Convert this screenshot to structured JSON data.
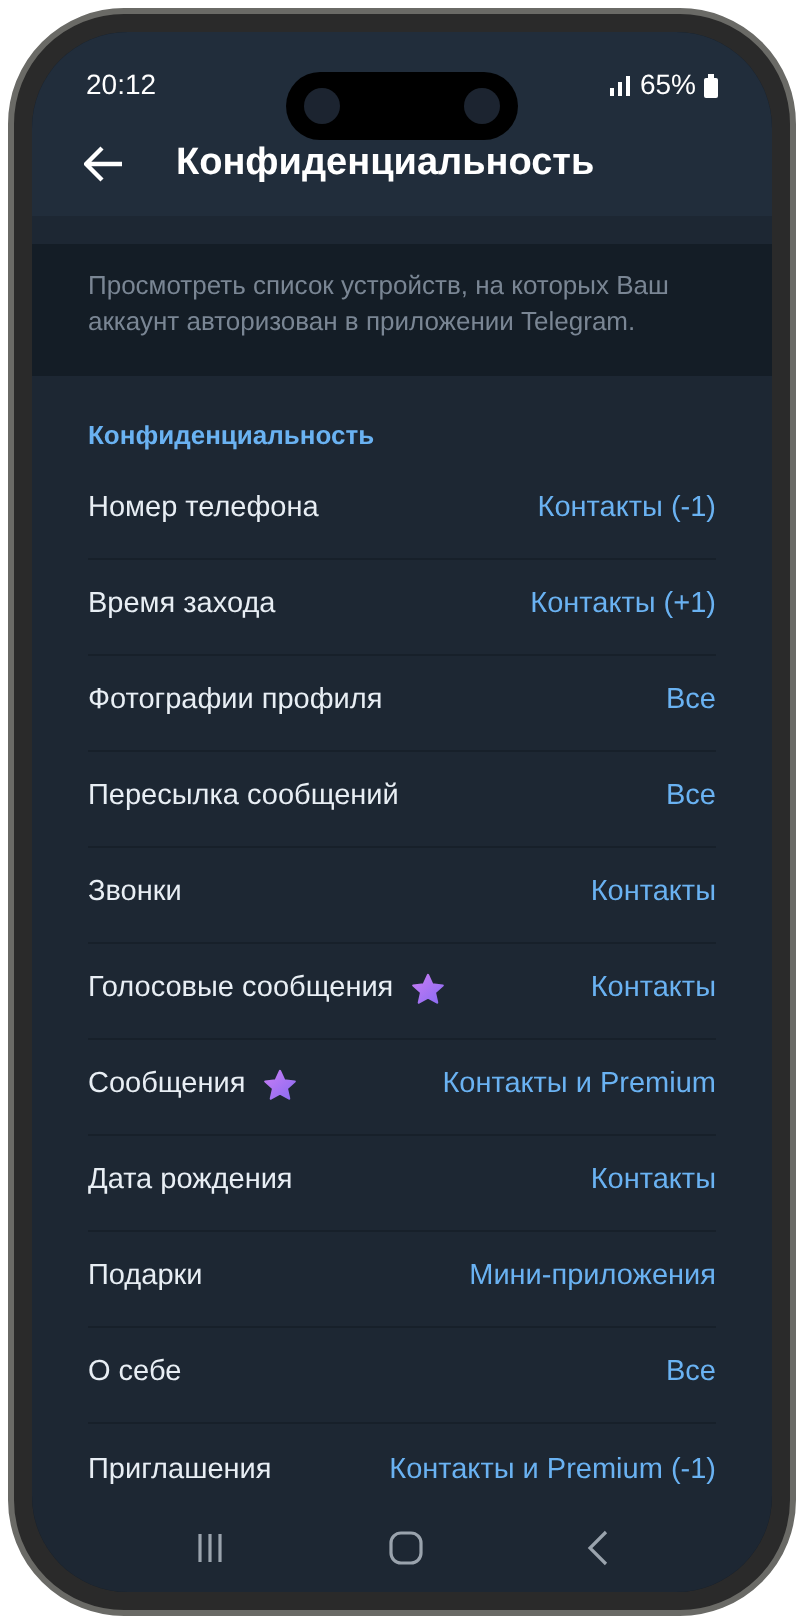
{
  "status_bar": {
    "time": "20:12",
    "battery": "65%"
  },
  "header": {
    "title": "Конфиденциальность"
  },
  "devices_note": "Просмотреть список устройств, на которых Ваш аккаунт авторизован в приложении Telegram.",
  "section": {
    "title": "Конфиденциальность",
    "rows": [
      {
        "label": "Номер телефона",
        "value": "Контакты (-1)",
        "premium": false
      },
      {
        "label": "Время захода",
        "value": "Контакты (+1)",
        "premium": false
      },
      {
        "label": "Фотографии профиля",
        "value": "Все",
        "premium": false
      },
      {
        "label": "Пересылка сообщений",
        "value": "Все",
        "premium": false
      },
      {
        "label": "Звонки",
        "value": "Контакты",
        "premium": false
      },
      {
        "label": "Голосовые сообщения",
        "value": "Контакты",
        "premium": true
      },
      {
        "label": "Сообщения",
        "value": "Контакты и Premium",
        "premium": true
      },
      {
        "label": "Дата рождения",
        "value": "Контакты",
        "premium": false
      },
      {
        "label": "Подарки",
        "value": "Мини-приложения",
        "premium": false
      },
      {
        "label": "О себе",
        "value": "Все",
        "premium": false
      },
      {
        "label": "Приглашения",
        "value": "Контакты и Premium (-1)",
        "premium": false
      }
    ]
  }
}
